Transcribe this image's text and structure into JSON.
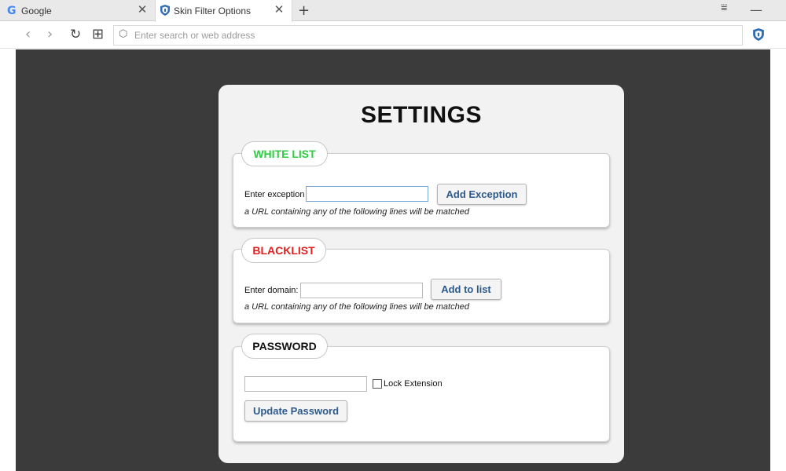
{
  "browser": {
    "tabs": [
      {
        "title": "Google",
        "logo": "G"
      },
      {
        "title": "Skin Filter Options"
      }
    ],
    "close_glyph": "✕",
    "new_tab_glyph": "+",
    "menu_glyph": "⩸",
    "minimize_glyph": "—",
    "nav": {
      "back": "‹",
      "forward": "›",
      "reload": "↻",
      "grid": "⊞"
    },
    "address": {
      "placeholder": "Enter search or web address",
      "value": "",
      "icon": "⬡"
    }
  },
  "settings": {
    "title": "SETTINGS",
    "whitelist": {
      "legend": "WHITE LIST",
      "label": "Enter exception",
      "input_value": "",
      "button": "Add Exception",
      "hint": "a URL containing any of the following lines will be matched"
    },
    "blacklist": {
      "legend": "BLACKLIST",
      "label": "Enter domain:",
      "input_value": "",
      "button": "Add to list",
      "hint": "a URL containing any of the following lines will be matched"
    },
    "password": {
      "legend": "PASSWORD",
      "input_value": "",
      "lock_label": "Lock Extension",
      "lock_checked": false,
      "button": "Update Password"
    }
  },
  "colors": {
    "whitelist_green": "#2ecc40",
    "blacklist_red": "#e02020",
    "button_text": "#2d5a8c",
    "content_bg": "#3b3b3b"
  }
}
